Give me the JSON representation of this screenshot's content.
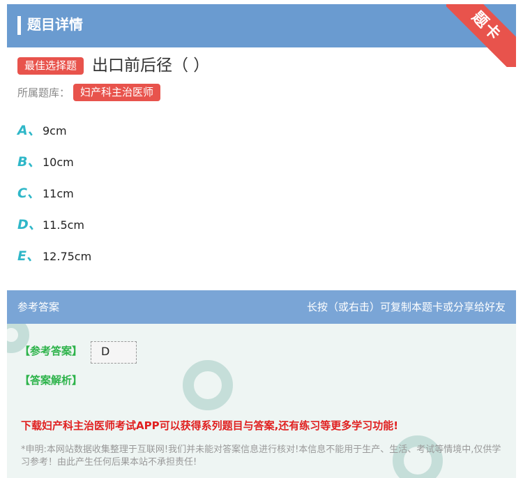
{
  "header": {
    "title": "题目详情",
    "ribbon": "题卡"
  },
  "question": {
    "type_tag": "最佳选择题",
    "title": "出口前后径（ ）",
    "bank_label": "所属题库：",
    "bank_tag": "妇产科主治医师"
  },
  "options": [
    {
      "letter": "A、",
      "text": "9cm"
    },
    {
      "letter": "B、",
      "text": "10cm"
    },
    {
      "letter": "C、",
      "text": "11cm"
    },
    {
      "letter": "D、",
      "text": "11.5cm"
    },
    {
      "letter": "E、",
      "text": "12.75cm"
    }
  ],
  "answer": {
    "header_left": "参考答案",
    "header_right": "长按（或右击）可复制本题卡或分享给好友",
    "ref_label": "【参考答案】",
    "ref_value": "D",
    "analysis_label": "【答案解析】",
    "promo": "下载妇产科主治医师考试APP可以获得系列题目与答案,还有练习等更多学习功能!",
    "disclaimer": "*申明:本网站数据收集整理于互联网!我们并未能对答案信息进行核对!本信息不能用于生产、生活、考试等情境中,仅供学习参考！由此产生任何后果本站不承担责任!"
  },
  "colors": {
    "header": "#6a9bd0",
    "accent_red": "#e8534c",
    "option_letter": "#2fb7c8",
    "answer_green": "#2db34a",
    "promo_red": "#e02020"
  }
}
